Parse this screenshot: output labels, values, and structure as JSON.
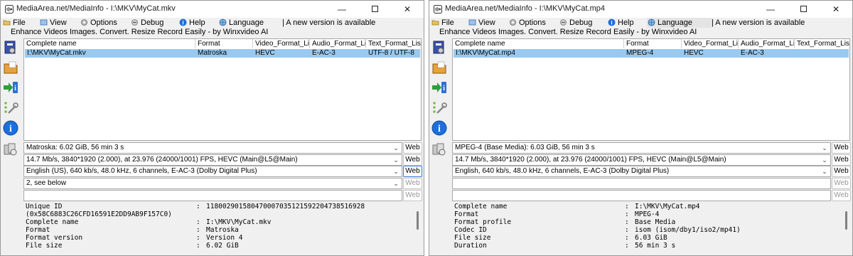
{
  "left_window": {
    "title": "MediaArea.net/MediaInfo - I:\\MKV\\MyCat.mkv",
    "menu": {
      "file": "File",
      "view": "View",
      "options": "Options",
      "debug": "Debug",
      "help": "Help",
      "language": "Language",
      "version_notice": "| A new version is available"
    },
    "ad_text": "Enhance Videos  Images. Convert. Resize  Record Easily - by Winxvideo AI",
    "columns": [
      "Complete name",
      "Format",
      "Video_Format_List",
      "Audio_Format_List",
      "Text_Format_List"
    ],
    "row": [
      "I:\\MKV\\MyCat.mkv",
      "Matroska",
      "HEVC",
      "E-AC-3",
      "UTF-8 / UTF-8"
    ],
    "summary_rows": [
      "Matroska: 6.02 GiB, 56 min 3 s",
      "14.7 Mb/s, 3840*1920 (2.000), at 23.976 (24000/1001) FPS, HEVC (Main@L5@Main)",
      "English (US), 640 kb/s, 48.0 kHz, 6 channels, E-AC-3 (Dolby Digital Plus)",
      "2, see below",
      ""
    ],
    "web_label": "Web",
    "details": [
      {
        "key": "Unique ID",
        "value": "118002901580470007035121592204738516928"
      },
      {
        "key": "(0x58C6883C26CFD16591E2DD9AB9F157C0)",
        "value": ""
      },
      {
        "key": "Complete name",
        "value": "I:\\MKV\\MyCat.mkv"
      },
      {
        "key": "Format",
        "value": "Matroska"
      },
      {
        "key": "Format version",
        "value": "Version 4"
      },
      {
        "key": "File size",
        "value": "6.02 GiB"
      }
    ]
  },
  "right_window": {
    "title": "MediaArea.net/MediaInfo - I:\\MKV\\MyCat.mp4",
    "menu": {
      "file": "File",
      "view": "View",
      "options": "Options",
      "debug": "Debug",
      "help": "Help",
      "language": "Language",
      "version_notice": "| A new version is available"
    },
    "ad_text": "Enhance Videos  Images. Convert. Resize  Record Easily - by Winxvideo AI",
    "columns": [
      "Complete name",
      "Format",
      "Video_Format_List",
      "Audio_Format_List",
      "Text_Format_List"
    ],
    "row": [
      "I:\\MKV\\MyCat.mp4",
      "MPEG-4",
      "HEVC",
      "E-AC-3",
      ""
    ],
    "summary_rows": [
      "MPEG-4 (Base Media): 6.03 GiB, 56 min 3 s",
      "14.7 Mb/s, 3840*1920 (2.000), at 23.976 (24000/1001) FPS, HEVC (Main@L5@Main)",
      "English, 640 kb/s, 48.0 kHz, 6 channels, E-AC-3 (Dolby Digital Plus)",
      "",
      ""
    ],
    "web_label": "Web",
    "details": [
      {
        "key": "Complete name",
        "value": "I:\\MKV\\MyCat.mp4"
      },
      {
        "key": "Format",
        "value": "MPEG-4"
      },
      {
        "key": "Format profile",
        "value": "Base Media"
      },
      {
        "key": "Codec ID",
        "value": "isom (isom/dby1/iso2/mp41)"
      },
      {
        "key": "File size",
        "value": "6.03 GiB"
      },
      {
        "key": "Duration",
        "value": "56 min 3 s"
      }
    ]
  },
  "colors": {
    "selection": "#99c9ef",
    "window_bg": "#f0f0f0",
    "help_blue": "#1e6fd9"
  }
}
